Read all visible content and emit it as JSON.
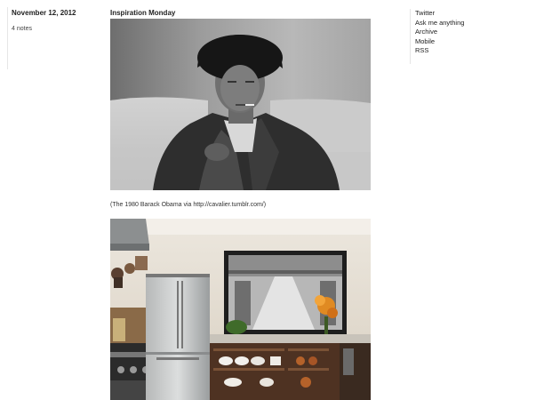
{
  "post_meta": {
    "date": "November 12, 2012",
    "notes": "4 notes"
  },
  "post": {
    "title": "Inspiration Monday",
    "caption": "(The 1980 Barack Obama via http://cavalier.tumblr.com/)"
  },
  "sidebar": {
    "links": [
      "Twitter",
      "Ask me anything",
      "Archive",
      "Mobile",
      "RSS"
    ]
  }
}
